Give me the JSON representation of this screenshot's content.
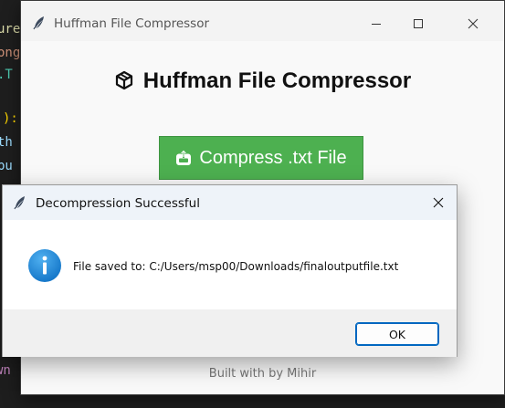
{
  "background_editor": {
    "fragments": [
      "ure",
      "ong",
      ".T",
      "):",
      "th",
      "pu",
      "wn"
    ]
  },
  "main_window": {
    "title": "Huffman File Compressor",
    "heading": "Huffman File Compressor",
    "compress_button_label": "Compress .txt File",
    "footer": "Built with  by Mihir"
  },
  "dialog": {
    "title": "Decompression Successful",
    "message": "File saved to: C:/Users/msp00/Downloads/finaloutputfile.txt",
    "ok_label": "OK",
    "icon": "info-icon"
  },
  "colors": {
    "compress_button": "#4db050",
    "info_icon": "#1a86d6",
    "ok_border": "#0067c0"
  }
}
